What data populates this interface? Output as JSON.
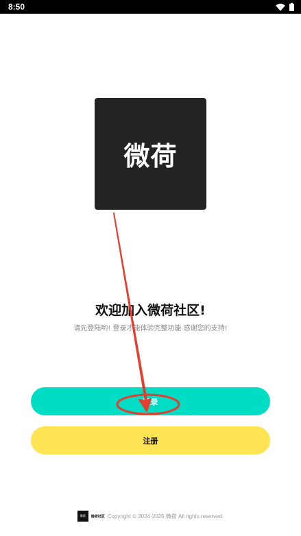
{
  "status_bar": {
    "time": "8:50",
    "icons": [
      "wifi-icon",
      "battery-icon"
    ]
  },
  "logo": {
    "text": "微荷"
  },
  "welcome": {
    "title": "欢迎加入微荷社区!",
    "subtitle": "请先登陆哟! 登录才能体验完整功能 感谢您的支持!"
  },
  "buttons": {
    "login_label": "登录",
    "register_label": "注册"
  },
  "footer": {
    "logo_text": "微荷",
    "brand_text": "微荷社区",
    "copyright": "Copyright © 2024-2025 微荷 All rights reserved."
  },
  "colors": {
    "login_button": "#00ddc4",
    "register_button": "#ffe454",
    "logo_background": "#232323",
    "annotation": "#e53d2f"
  }
}
